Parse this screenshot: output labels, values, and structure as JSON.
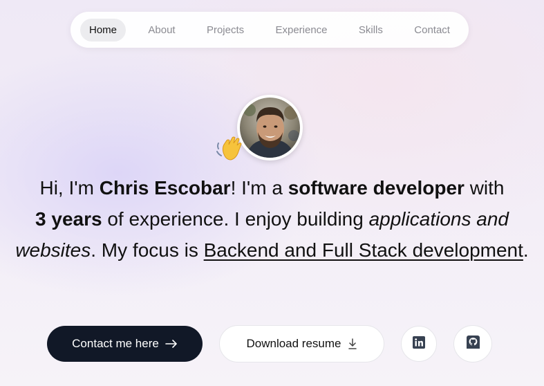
{
  "nav": {
    "items": [
      {
        "label": "Home",
        "active": true
      },
      {
        "label": "About",
        "active": false
      },
      {
        "label": "Projects",
        "active": false
      },
      {
        "label": "Experience",
        "active": false
      },
      {
        "label": "Skills",
        "active": false
      },
      {
        "label": "Contact",
        "active": false
      }
    ]
  },
  "hero": {
    "avatar_icon": "profile-photo",
    "wave_icon": "waving-hand-icon",
    "intro": {
      "greeting": "Hi, I'm ",
      "name": "Chris Escobar",
      "im_a": "! I'm a ",
      "role": "software developer",
      "with": " with",
      "years": "3 years",
      "experience_text": " of experience. I enjoy building ",
      "building": "applications and websites",
      "focus_text": ". My focus is ",
      "focus": "Backend and Full Stack development",
      "end": "."
    }
  },
  "buttons": {
    "contact_label": "Contact me here",
    "resume_label": "Download resume",
    "linkedin_icon": "linkedin-icon",
    "github_icon": "github-icon"
  },
  "colors": {
    "primary_button": "#111827",
    "nav_active_bg": "#ececef",
    "nav_inactive_text": "#8b8b92"
  }
}
